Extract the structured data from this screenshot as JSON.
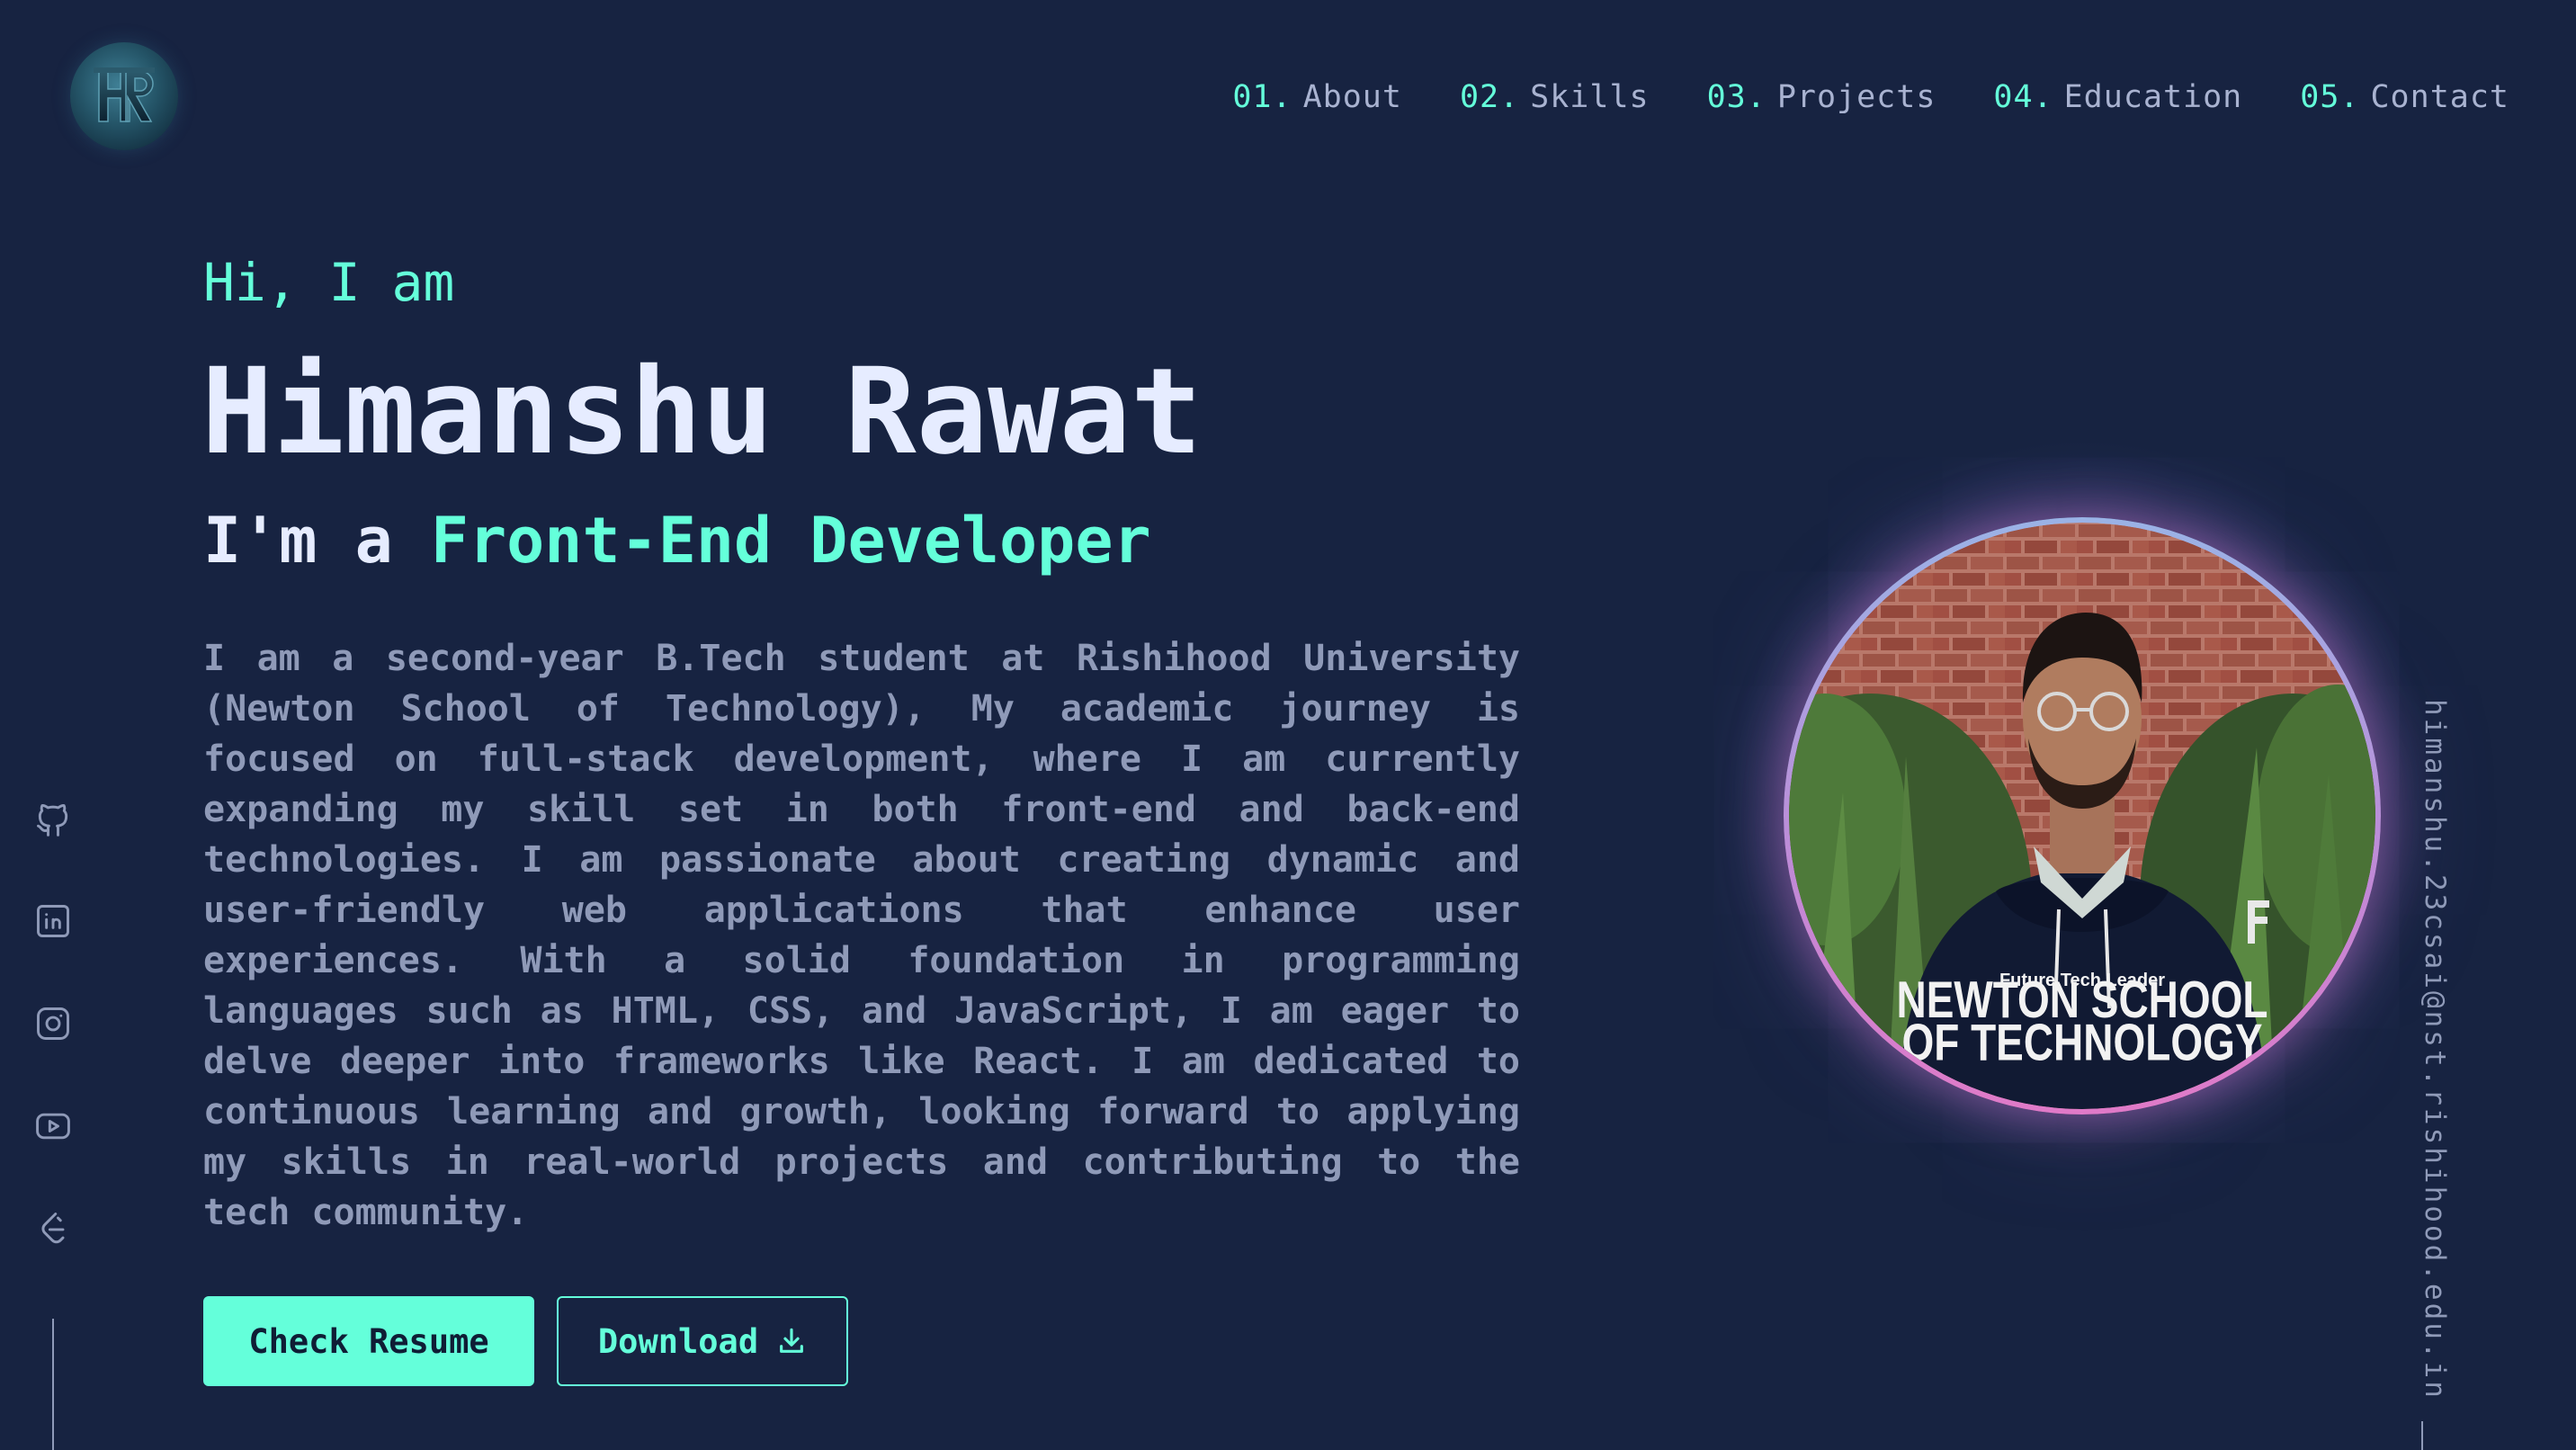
{
  "nav": {
    "items": [
      {
        "num": "01.",
        "label": "About"
      },
      {
        "num": "02.",
        "label": "Skills"
      },
      {
        "num": "03.",
        "label": "Projects"
      },
      {
        "num": "04.",
        "label": "Education"
      },
      {
        "num": "05.",
        "label": "Contact"
      }
    ]
  },
  "hero": {
    "greeting": "Hi, I am",
    "name": "Himanshu Rawat",
    "role_prefix": "I'm a ",
    "role": "Front-End Developer",
    "about": "I am a second-year B.Tech student at Rishihood University (Newton School of Technology), My academic journey is focused on full-stack development, where I am currently expanding my skill set in both front-end and back-end technologies. I am passionate about creating dynamic and user-friendly web applications that enhance user experiences. With a solid foundation in programming languages such as HTML, CSS, and JavaScript, I am eager to delve deeper into frameworks like React. I am dedicated to continuous learning and growth, looking forward to applying my skills in real-world projects and contributing to the tech community."
  },
  "buttons": {
    "resume_label": "Check Resume",
    "download_label": "Download"
  },
  "profile": {
    "hoodie_line1": "NEWTON SCHOOL",
    "hoodie_line2": "OF TECHNOLOGY",
    "hoodie_line3": "Future Tech Leader"
  },
  "socials": [
    "github-icon",
    "linkedin-icon",
    "instagram-icon",
    "youtube-icon",
    "leetcode-icon"
  ],
  "email": "himanshu.23csai@nst.rishihood.edu.in",
  "colors": {
    "background": "#172341",
    "accent": "#64ffda",
    "text_primary": "#e6ecff",
    "text_secondary": "#8f9ab8"
  }
}
